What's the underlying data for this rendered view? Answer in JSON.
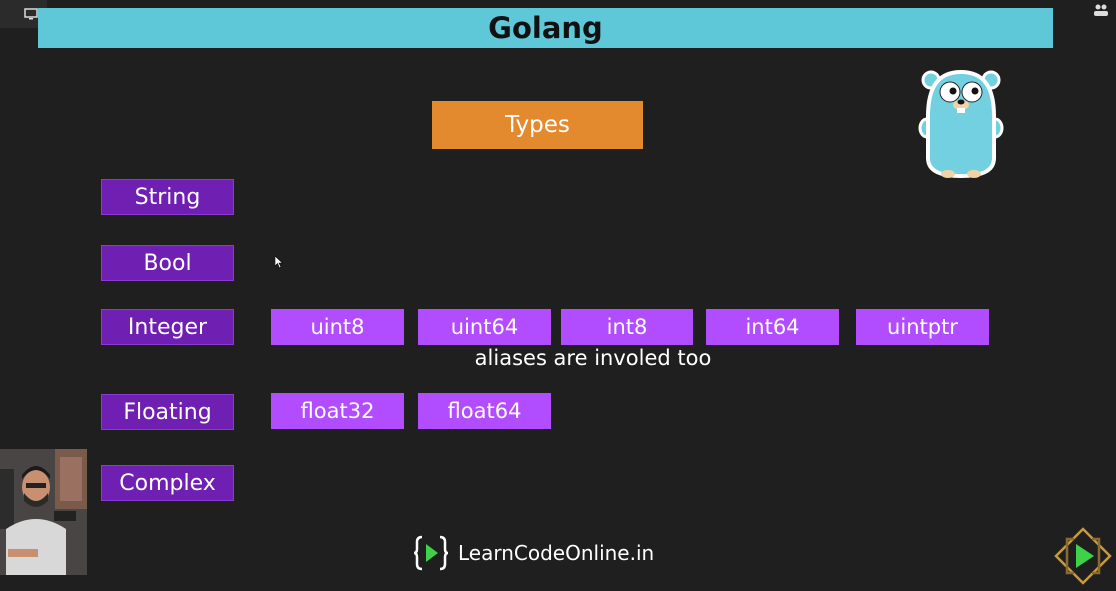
{
  "header": {
    "title": "Golang"
  },
  "types_label": "Types",
  "categories": [
    {
      "label": "String"
    },
    {
      "label": "Bool"
    },
    {
      "label": "Integer"
    },
    {
      "label": "Floating"
    },
    {
      "label": "Complex"
    }
  ],
  "integer_subtypes": [
    "uint8",
    "uint64",
    "int8",
    "int64",
    "uintptr"
  ],
  "aliases_note": "aliases are involed too",
  "floating_subtypes": [
    "float32",
    "float64"
  ],
  "footer": {
    "brand": "LearnCodeOnline.in"
  },
  "colors": {
    "title_bar": "#5ec8d8",
    "types_box": "#e38a2e",
    "category": "#6f1fb2",
    "subtype": "#b24dff",
    "background": "#1f1f1f"
  }
}
